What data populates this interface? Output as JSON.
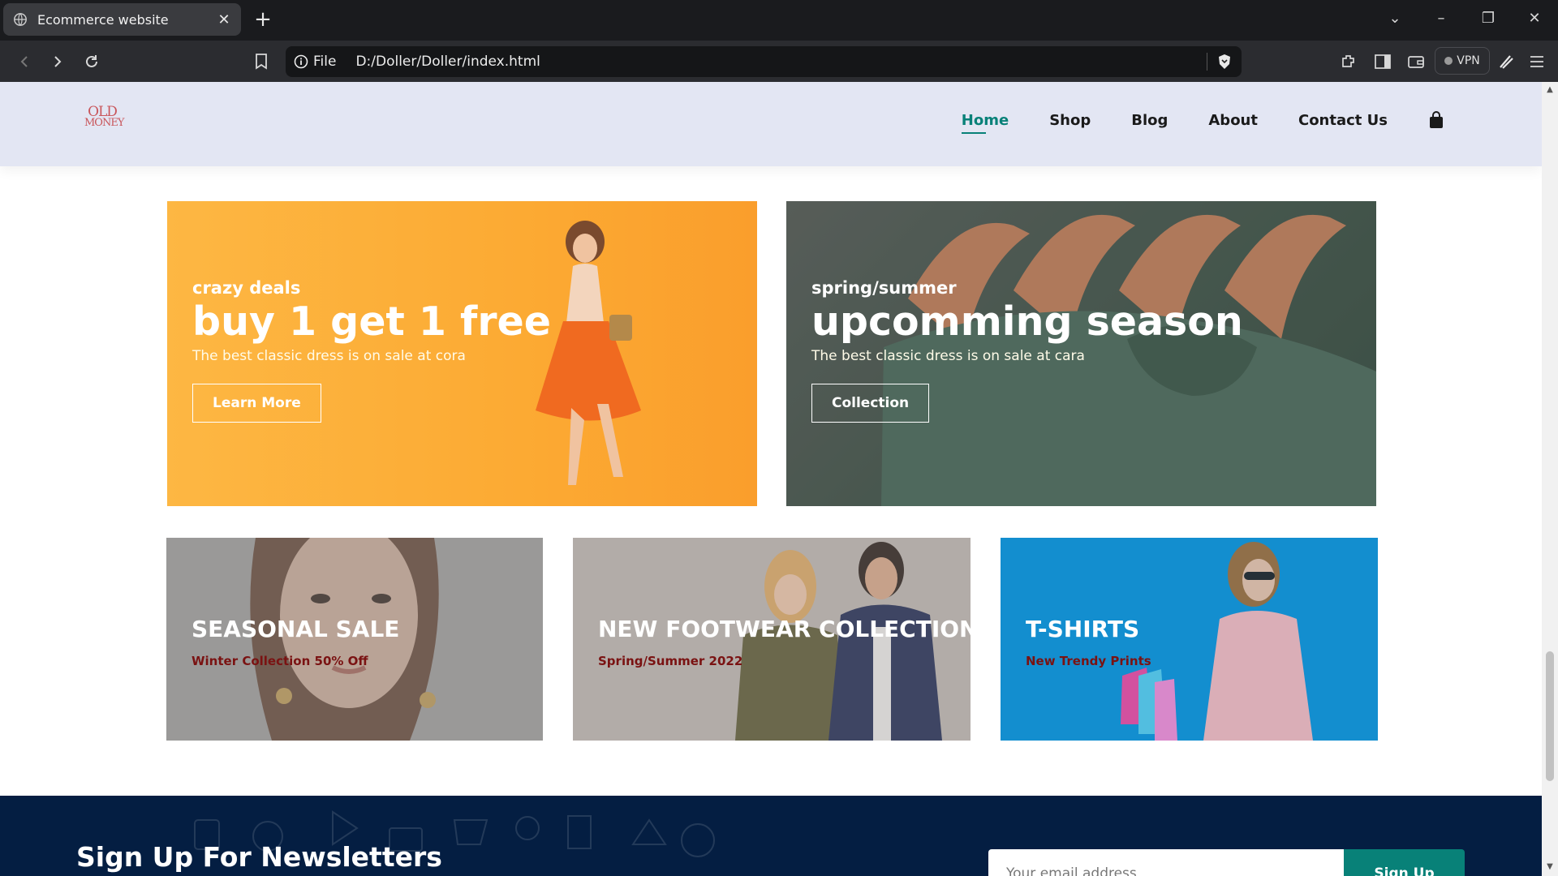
{
  "browser": {
    "tab_title": "Ecommerce website",
    "url_scheme": "File",
    "url": "D:/Doller/Doller/index.html",
    "vpn_label": "VPN"
  },
  "header": {
    "logo_line1": "OLD",
    "logo_line2": "MONEY",
    "nav": [
      "Home",
      "Shop",
      "Blog",
      "About",
      "Contact Us"
    ],
    "active": "Home"
  },
  "banners": {
    "deal": {
      "kicker": "crazy deals",
      "headline": "buy 1 get 1 free",
      "description": "The best classic dress is on sale at cora",
      "button": "Learn More"
    },
    "season": {
      "kicker": "spring/summer",
      "headline": "upcomming season",
      "description": "The best classic dress is on sale at cara",
      "button": "Collection"
    },
    "small": [
      {
        "title": "SEASONAL SALE",
        "subtitle": "Winter Collection 50% Off"
      },
      {
        "title": "NEW FOOTWEAR COLLECTION",
        "subtitle": "Spring/Summer 2022"
      },
      {
        "title": "T-SHIRTS",
        "subtitle": "New Trendy Prints"
      }
    ]
  },
  "newsletter": {
    "heading": "Sign Up For Newsletters",
    "placeholder": "Your email address",
    "button": "Sign Up"
  },
  "colors": {
    "accent": "#088178",
    "header_bg": "#e3e6f3",
    "newsletter_bg": "#041e42",
    "deal_bg": "#fcaa33",
    "tshirt_bg": "#1592d3"
  }
}
